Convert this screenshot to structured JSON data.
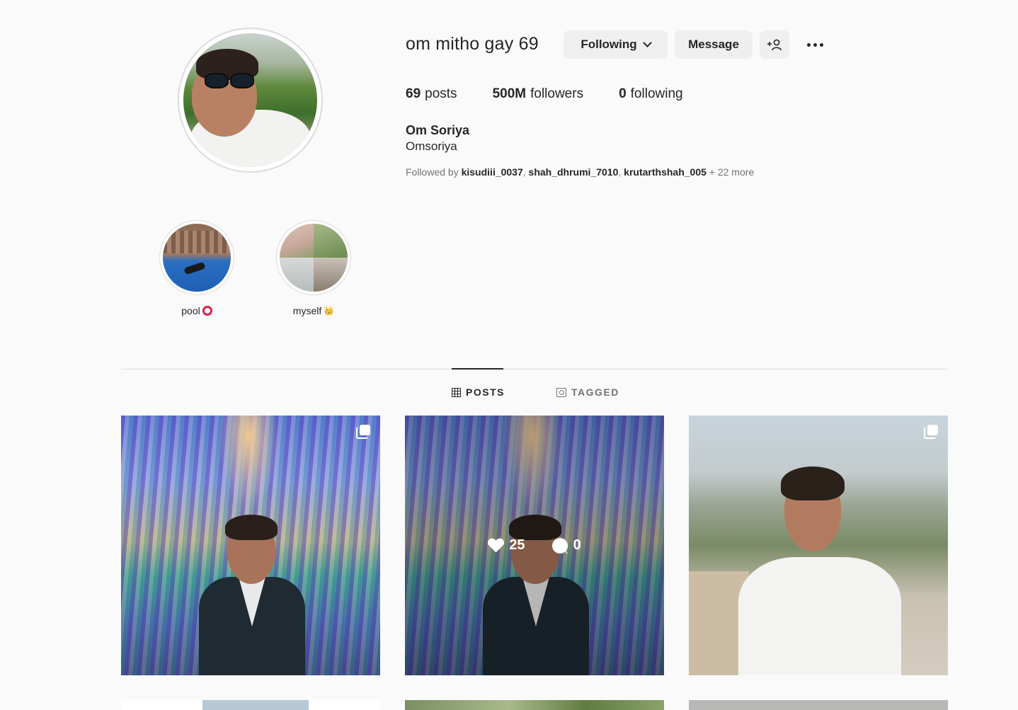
{
  "profile": {
    "username": "om mitho gay 69",
    "following_button": "Following",
    "message_button": "Message",
    "add_user_icon": "+♀",
    "stats": {
      "posts_count": "69",
      "posts_label": "posts",
      "followers_count": "500M",
      "followers_label": "followers",
      "following_count": "0",
      "following_label": "following"
    },
    "full_name": "Om Soriya",
    "bio": "Omsoriya",
    "followed_by": {
      "prefix": "Followed by",
      "accounts": [
        "kisudiii_0037",
        "shah_dhrumi_7010",
        "krutarthshah_005"
      ],
      "suffix": "+ 22 more"
    }
  },
  "highlights": [
    {
      "label": "pool",
      "emoji_icon": "red-ring-icon"
    },
    {
      "label": "myself",
      "emoji_icon": "crown-icon",
      "emoji": "👑"
    }
  ],
  "tabs": [
    {
      "label": "POSTS",
      "icon": "grid-icon",
      "active": true
    },
    {
      "label": "TAGGED",
      "icon": "tagged-icon",
      "active": false
    }
  ],
  "posts": [
    {
      "multi": true
    },
    {
      "multi": false,
      "hover": {
        "likes": "25",
        "comments": "0"
      }
    },
    {
      "multi": true
    }
  ],
  "colors": {
    "background": "#fafafa",
    "button": "#efefef",
    "text": "#262626",
    "muted": "#737373",
    "highlight_ring_emoji": "#e01e4a"
  }
}
